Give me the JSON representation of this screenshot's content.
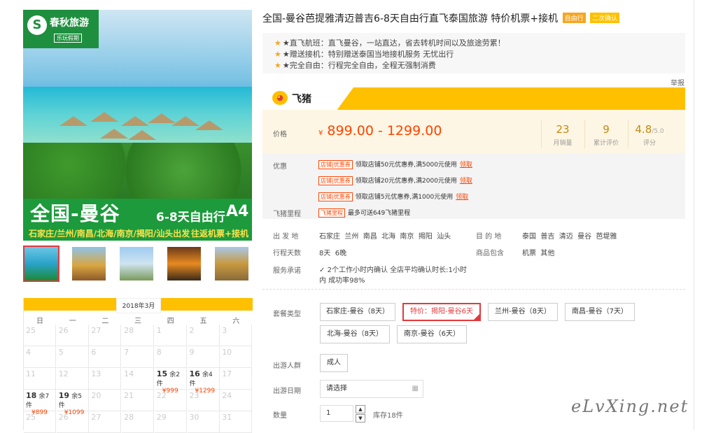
{
  "product": {
    "title": "全国-曼谷芭提雅清迈普吉6-8天自由行直飞泰国旅游 特价机票+接机",
    "badges": [
      "自由行",
      "二次确认"
    ],
    "features": [
      "★直飞航班：直飞曼谷，一站直达，省去转机时间以及旅途劳累！",
      "★赠送接机：特别赠送泰国当地接机服务 无忧出行",
      "★完全自由：行程完全自由，全程无强制消费"
    ],
    "report": "举报"
  },
  "hero": {
    "brand": "春秋旅游",
    "brand_sub": "乐玩假期",
    "title": "全国-曼谷",
    "tagline": "6-8天自由行",
    "code": "A4",
    "cities": "石家庄/兰州/南昌/北海/南京/揭阳/汕头出发",
    "extras": "往返机票+接机"
  },
  "platform": {
    "name": "飞猪"
  },
  "price": {
    "label": "价格",
    "currency": "¥",
    "range": "899.00 - 1299.00",
    "stats": [
      {
        "value": "23",
        "label": "月销量"
      },
      {
        "value": "9",
        "label": "累计评价"
      },
      {
        "value": "4.8",
        "suffix": "/5.0",
        "label": "评分"
      }
    ]
  },
  "promo": {
    "label": "优惠",
    "coupon_tag": "店铺|优惠券",
    "coupons": [
      "领取店铺50元优惠券,满5000元使用",
      "领取店铺20元优惠券,满2000元使用",
      "领取店铺5元优惠券,满1000元使用"
    ],
    "claim": "领取",
    "mileage_label": "飞猪里程",
    "mileage_tag": "飞猪里程",
    "mileage_text": "最多可送649飞猪里程"
  },
  "details": {
    "depart_label": "出 发 地",
    "depart_value": "石家庄  兰州  南昌  北海  南京  揭阳  汕头",
    "dest_label": "目 的 地",
    "dest_value": "泰国  普吉  清迈  曼谷  芭堤雅",
    "days_label": "行程天数",
    "days_value": "8天  6晚",
    "include_label": "商品包含",
    "include_value": "机票  其他",
    "service_label": "服务承诺",
    "service_value1": "2个工作小时内确认 全店平均确认时长:1小时",
    "service_value2": "内 成功率98%"
  },
  "options": {
    "package_label": "套餐类型",
    "packages": [
      "石家庄-曼谷（8天）",
      "特价：揭阳-曼谷6天",
      "兰州-曼谷（8天）",
      "南昌-曼谷（7天）",
      "北海-曼谷（8天）",
      "南京-曼谷（6天）"
    ],
    "selected_package": 1,
    "people_label": "出游人群",
    "people_value": "成人",
    "date_label": "出游日期",
    "date_placeholder": "请选择",
    "qty_label": "数量",
    "qty_value": "1",
    "stock": "库存18件"
  },
  "calendar": {
    "month": "2018年3月",
    "weekdays": [
      "日",
      "一",
      "二",
      "三",
      "四",
      "五",
      "六"
    ],
    "rows": [
      [
        {
          "d": "25"
        },
        {
          "d": "26"
        },
        {
          "d": "27"
        },
        {
          "d": "28"
        },
        {
          "d": "1"
        },
        {
          "d": "2"
        },
        {
          "d": "3"
        }
      ],
      [
        {
          "d": "4"
        },
        {
          "d": "5"
        },
        {
          "d": "6"
        },
        {
          "d": "7"
        },
        {
          "d": "8"
        },
        {
          "d": "9"
        },
        {
          "d": "10"
        }
      ],
      [
        {
          "d": "11"
        },
        {
          "d": "12"
        },
        {
          "d": "13"
        },
        {
          "d": "14"
        },
        {
          "d": "15",
          "c": "余2件",
          "p": "¥999"
        },
        {
          "d": "16",
          "c": "余4件",
          "p": "¥1299"
        },
        {
          "d": "17"
        }
      ],
      [
        {
          "d": "18",
          "c": "余7件",
          "p": "¥899"
        },
        {
          "d": "19",
          "c": "余5件",
          "p": "¥1099"
        },
        {
          "d": "20"
        },
        {
          "d": "21"
        },
        {
          "d": "22"
        },
        {
          "d": "23"
        },
        {
          "d": "24"
        }
      ],
      [
        {
          "d": "25"
        },
        {
          "d": "26"
        },
        {
          "d": "27"
        },
        {
          "d": "28"
        },
        {
          "d": "29"
        },
        {
          "d": "30"
        },
        {
          "d": "31"
        }
      ]
    ]
  },
  "watermark": "eLvXing.net",
  "colors": {
    "accent": "#ffc000",
    "price": "#ff4400",
    "brand_green": "#1e8f3e"
  }
}
